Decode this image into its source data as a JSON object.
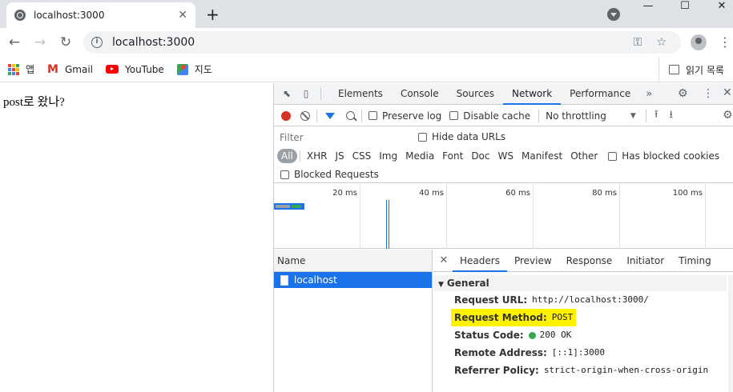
{
  "browser": {
    "tab_title": "localhost:3000",
    "tab_close": "✕",
    "new_tab": "+",
    "url": "localhost:3000",
    "window_min": "—",
    "window_max": "☐",
    "window_close": "✕"
  },
  "bookmarks": {
    "items": [
      {
        "label": "앱",
        "icon": "apps-icon"
      },
      {
        "label": "Gmail",
        "icon": "gmail-icon"
      },
      {
        "label": "YouTube",
        "icon": "youtube-icon"
      },
      {
        "label": "지도",
        "icon": "maps-icon"
      }
    ],
    "reading_list": "읽기 목록"
  },
  "page": {
    "text": "post로 왔나?"
  },
  "devtools": {
    "tabs": [
      "Elements",
      "Console",
      "Sources",
      "Network",
      "Performance"
    ],
    "active_tab": "Network",
    "more": "»",
    "network": {
      "preserve_log": "Preserve log",
      "disable_cache": "Disable cache",
      "throttling": "No throttling",
      "filter_placeholder": "Filter",
      "hide_data_urls": "Hide data URLs",
      "types": [
        "All",
        "XHR",
        "JS",
        "CSS",
        "Img",
        "Media",
        "Font",
        "Doc",
        "WS",
        "Manifest",
        "Other"
      ],
      "has_blocked_cookies": "Has blocked cookies",
      "blocked_requests": "Blocked Requests",
      "timeline_ticks": [
        "20 ms",
        "40 ms",
        "60 ms",
        "80 ms",
        "100 ms"
      ],
      "name_header": "Name",
      "requests": [
        "localhost"
      ],
      "detail_tabs": [
        "Headers",
        "Preview",
        "Response",
        "Initiator",
        "Timing"
      ],
      "active_detail_tab": "Headers",
      "general_title": "General",
      "headers": {
        "request_url_key": "Request URL:",
        "request_url_val": "http://localhost:3000/",
        "request_method_key": "Request Method:",
        "request_method_val": "POST",
        "status_code_key": "Status Code:",
        "status_code_val": "200 OK",
        "remote_address_key": "Remote Address:",
        "remote_address_val": "[::1]:3000",
        "referrer_policy_key": "Referrer Policy:",
        "referrer_policy_val": "strict-origin-when-cross-origin"
      }
    }
  },
  "colors": {
    "accent": "#1a73e8",
    "highlight": "#fff200",
    "record": "#d93025",
    "status_ok": "#34a853"
  }
}
